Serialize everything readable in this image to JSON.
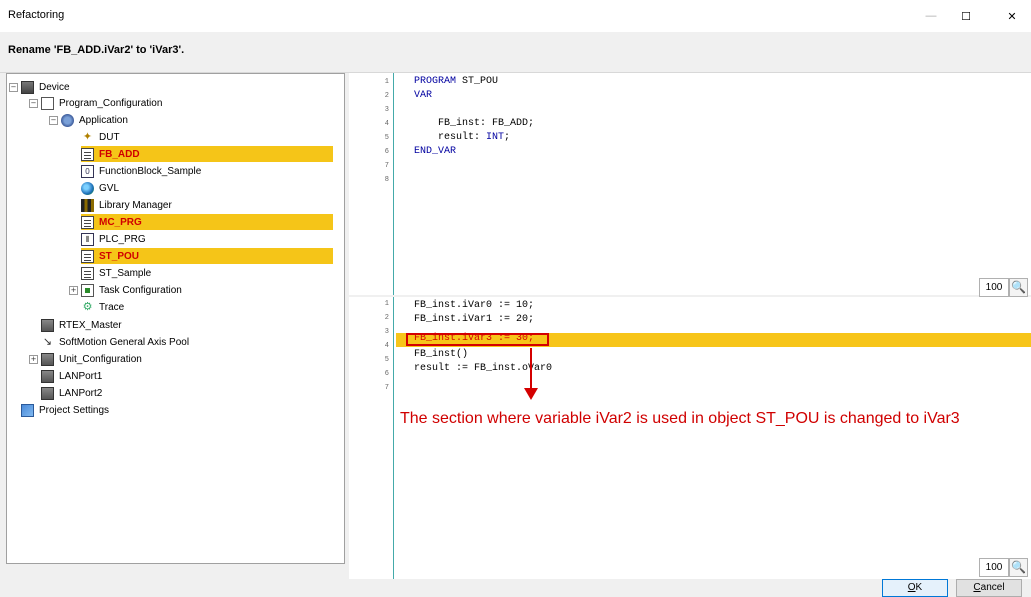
{
  "window": {
    "title": "Refactoring",
    "min_glyph": "—",
    "max_glyph": "☐",
    "close_glyph": "✕"
  },
  "header": {
    "message": "Rename 'FB_ADD.iVar2' to 'iVar3'."
  },
  "tree": {
    "expander_minus": "−",
    "expander_plus": "+",
    "nodes": [
      {
        "label": "Device",
        "icon": "device-icon"
      },
      {
        "label": "Program_Configuration",
        "icon": "configuration-icon"
      },
      {
        "label": "Application",
        "icon": "application-icon"
      },
      {
        "label": "DUT",
        "icon": "dut-icon",
        "glyph": "✦"
      },
      {
        "label": "FB_ADD",
        "icon": "pou-icon",
        "highlighted": true
      },
      {
        "label": "FunctionBlock_Sample",
        "icon": "function-block-icon",
        "glyph": "0"
      },
      {
        "label": "GVL",
        "icon": "globe-icon"
      },
      {
        "label": "Library Manager",
        "icon": "library-icon"
      },
      {
        "label": "MC_PRG",
        "icon": "pou-icon",
        "highlighted": true
      },
      {
        "label": "PLC_PRG",
        "icon": "plc-program-icon",
        "glyph": "⫴"
      },
      {
        "label": "ST_POU",
        "icon": "pou-icon",
        "highlighted": true
      },
      {
        "label": "ST_Sample",
        "icon": "pou-icon"
      },
      {
        "label": "Task Configuration",
        "icon": "task-configuration-icon"
      },
      {
        "label": "Trace",
        "icon": "trace-icon",
        "glyph": "⚙"
      },
      {
        "label": "RTEX_Master",
        "icon": "device-icon"
      },
      {
        "label": "SoftMotion General Axis Pool",
        "icon": "axis-pool-icon",
        "glyph": "↘"
      },
      {
        "label": "Unit_Configuration",
        "icon": "device-icon"
      },
      {
        "label": "LANPort1",
        "icon": "port-icon"
      },
      {
        "label": "LANPort2",
        "icon": "port-icon"
      },
      {
        "label": "Project Settings",
        "icon": "project-settings-icon"
      }
    ]
  },
  "declaration": {
    "line_numbers": [
      "1",
      "2",
      "3",
      "4",
      "5",
      "6",
      "7",
      "8"
    ],
    "lines": [
      {
        "kw": "PROGRAM",
        "text": " ST_POU"
      },
      {
        "kw": "VAR",
        "text": ""
      },
      {
        "kw": "",
        "text": ""
      },
      {
        "kw": "",
        "text": "    FB_inst: FB_ADD;"
      },
      {
        "kw": "",
        "text": "    result: ",
        "kw2": "INT",
        "tail": ";"
      },
      {
        "kw": "END_VAR",
        "text": ""
      },
      {
        "kw": "",
        "text": ""
      },
      {
        "kw": "",
        "text": ""
      }
    ],
    "zoom": "100"
  },
  "implementation": {
    "line_numbers": [
      "1",
      "2",
      "3",
      "4",
      "5",
      "6",
      "7"
    ],
    "lines": [
      "FB_inst.iVar0 := 10;",
      "FB_inst.iVar1 := 20;",
      "FB_inst.iVar3 := 30;",
      "FB_inst()",
      "result := FB_inst.oVar0",
      "",
      ""
    ],
    "highlight_line": 3,
    "zoom": "100"
  },
  "annotation": {
    "text": "The section where variable iVar2 is used in object ST_POU is changed to iVar3"
  },
  "buttons": {
    "ok_accel": "O",
    "ok_rest": "K",
    "cancel_accel": "C",
    "cancel_rest": "ancel"
  },
  "colors": {
    "highlight": "#f5c518",
    "annotation": "#d00000"
  }
}
